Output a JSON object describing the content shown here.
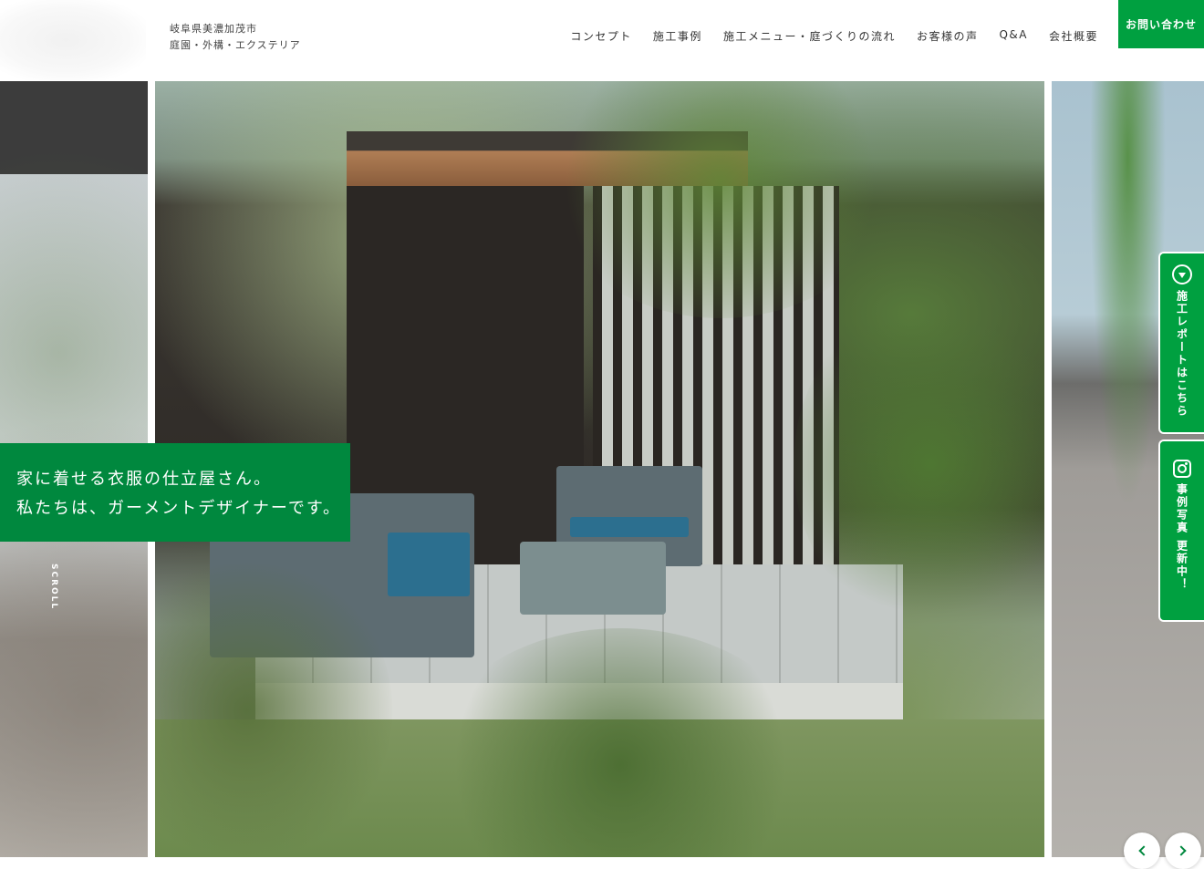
{
  "header": {
    "tagline_line1": "岐阜県美濃加茂市",
    "tagline_line2": "庭園・外構・エクステリア",
    "nav": [
      {
        "label": "コンセプト"
      },
      {
        "label": "施工事例"
      },
      {
        "label": "施工メニュー・庭づくりの流れ"
      },
      {
        "label": "お客様の声"
      },
      {
        "label": "Q&A"
      },
      {
        "label": "会社概要"
      }
    ],
    "contact_label": "お問い合わせ"
  },
  "hero": {
    "caption_line1": "家に着せる衣服の仕立屋さん。",
    "caption_line2": "私たちは、ガーメントデザイナーです。",
    "scroll_label": "SCROLL"
  },
  "side_tabs": {
    "report": {
      "label": "施工レポートはこちら",
      "icon": "circle-down-icon"
    },
    "instagram": {
      "label": "事例写真 更新中！",
      "icon": "instagram-icon"
    }
  },
  "slider": {
    "prev_icon": "chevron-left-icon",
    "next_icon": "chevron-right-icon"
  },
  "colors": {
    "brand_green": "#00a040",
    "caption_green": "#00883e",
    "text": "#333333"
  }
}
